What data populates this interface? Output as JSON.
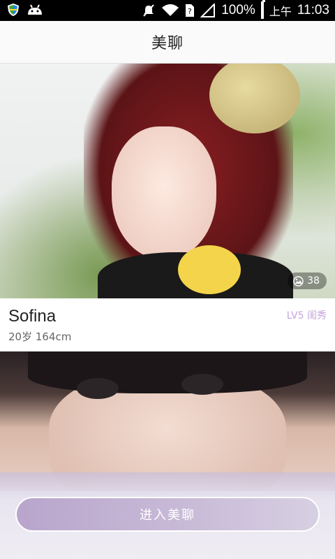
{
  "status_bar": {
    "battery": "100%",
    "time_label": "上午",
    "time": "11:03",
    "icons": [
      "shield-icon",
      "android-icon",
      "mute-icon",
      "wifi-icon",
      "sim-alert-icon",
      "signal-icon",
      "battery-icon"
    ]
  },
  "app_bar": {
    "title": "美聊"
  },
  "profiles": [
    {
      "name": "Sofina",
      "meta": "20岁  164cm",
      "level": "LV5",
      "level_title": "闺秀",
      "photo_count": "38"
    }
  ],
  "footer": {
    "enter_label": "进入美聊"
  },
  "colors": {
    "accent": "#c5a4dd",
    "button": "#b9a5cc"
  }
}
